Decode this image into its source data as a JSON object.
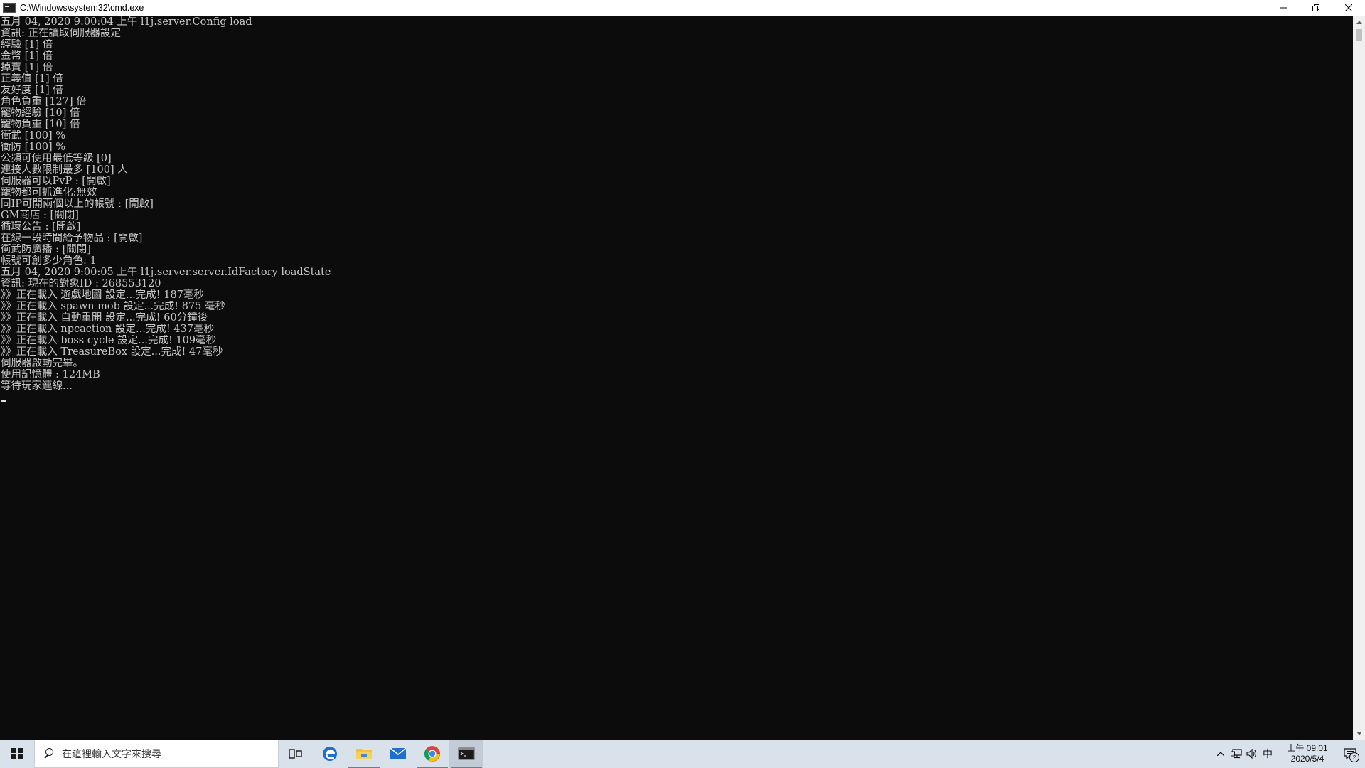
{
  "window": {
    "title": "C:\\Windows\\system32\\cmd.exe",
    "controls": {
      "minimize": "—",
      "restore": "❐",
      "close": "✕"
    }
  },
  "console": {
    "lines": [
      "五月 04, 2020 9:00:04 上午 l1j.server.Config load",
      "資訊: 正在讀取伺服器設定",
      "經驗 [1] 倍",
      "金幣 [1] 倍",
      "掉寶 [1] 倍",
      "正義值 [1] 倍",
      "友好度 [1] 倍",
      "角色負重 [127] 倍",
      "寵物經驗 [10] 倍",
      "寵物負重 [10] 倍",
      "衝武 [100] %",
      "衝防 [100] %",
      "公頻可使用最低等級 [0]",
      "連接人數限制最多 [100] 人",
      "伺服器可以PvP : [開啟]",
      "寵物都可抓進化:無效",
      "同IP可開兩個以上的帳號 : [開啟]",
      "GM商店 : [關閉]",
      "循環公告 : [開啟]",
      "在線一段時間給予物品 : [開啟]",
      "衝武防廣播 : [關閉]",
      "帳號可創多少角色: 1",
      "五月 04, 2020 9:00:05 上午 l1j.server.server.IdFactory loadState",
      "資訊: 現在的對象ID : 268553120",
      "》》正在載入 遊戲地圖 設定...完成! 187毫秒",
      "》》正在載入 spawn mob 設定...完成! 875 毫秒",
      "》》正在載入 自動重開 設定...完成! 60分鐘後",
      "》》正在載入 npcaction 設定...完成! 437毫秒",
      "》》正在載入 boss cycle 設定...完成! 109毫秒",
      "》》正在載入 TreasureBox 設定...完成! 47毫秒",
      "伺服器啟動完畢。",
      "使用記憶體 : 124MB",
      "等待玩家連線..."
    ]
  },
  "taskbar": {
    "search_placeholder": "在這裡輸入文字來搜尋",
    "apps": [
      "task-view",
      "edge",
      "file-explorer",
      "mail",
      "chrome",
      "cmd"
    ],
    "tray": {
      "chevron": "^",
      "ime": "中",
      "time": "上午 09:01",
      "date": "2020/5/4",
      "notification_count": "2"
    }
  },
  "colors": {
    "console_bg": "#0c0c0c",
    "console_text": "#c8c8c8",
    "taskbar_bg": "#d9e1ea",
    "accent": "#3b87d8"
  }
}
